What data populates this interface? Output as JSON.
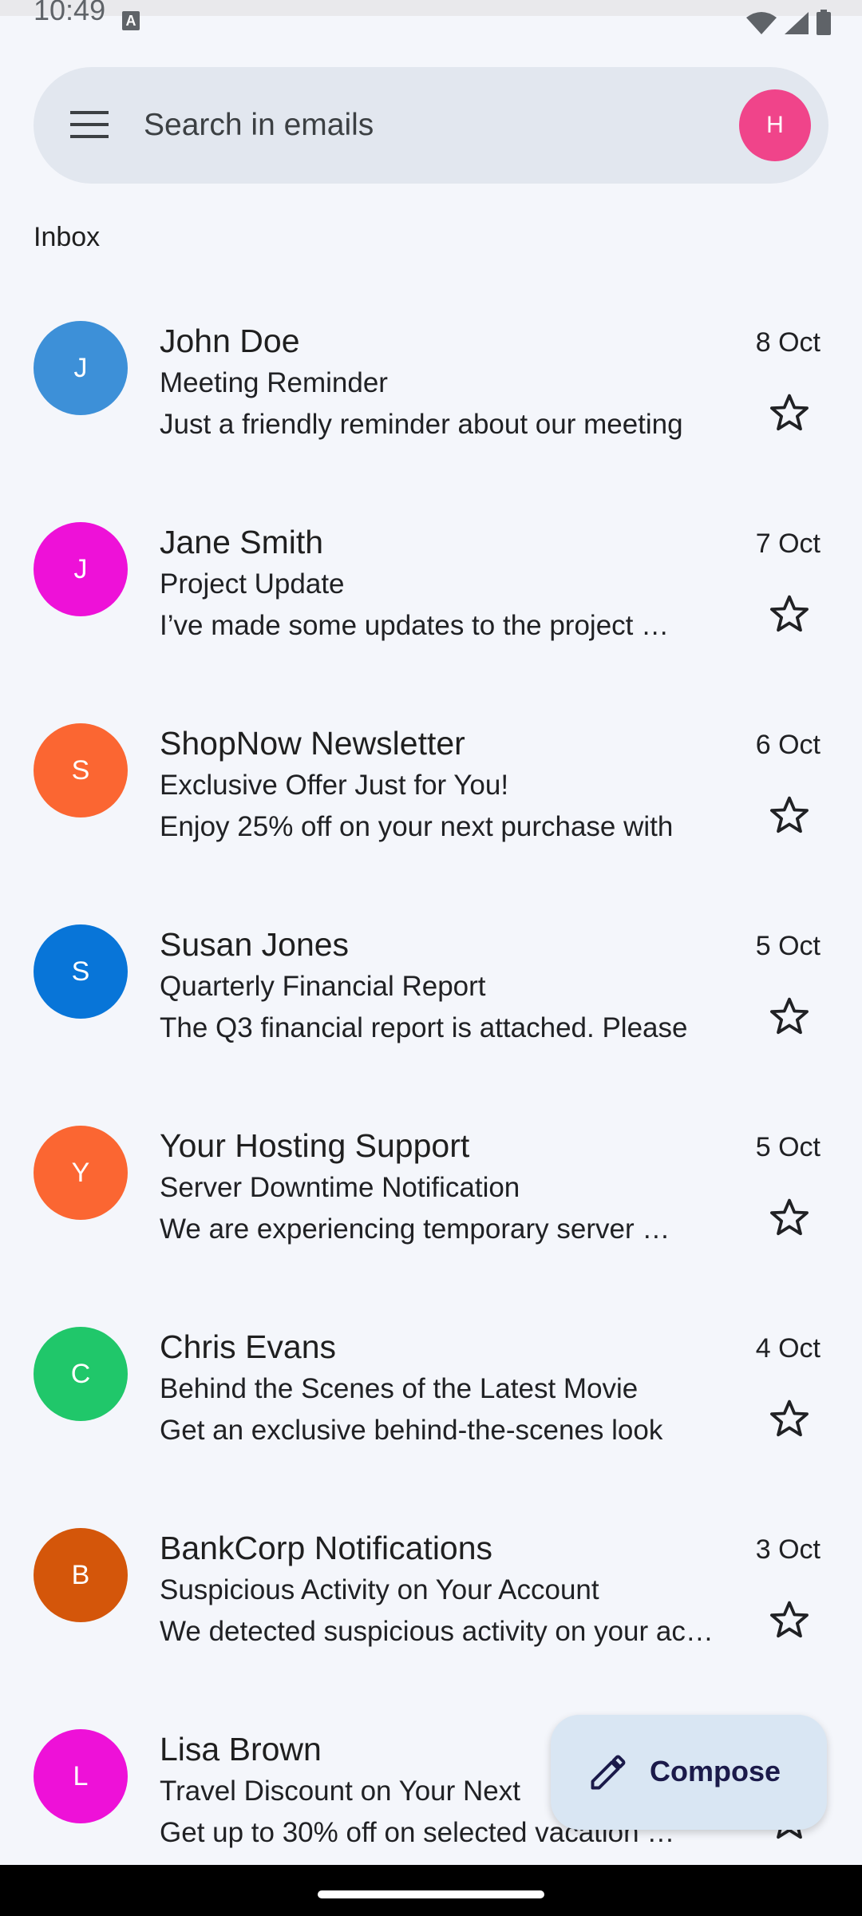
{
  "status_bar": {
    "time": "10:49",
    "indicator": "A",
    "icons": [
      "wifi-icon",
      "signal-icon",
      "battery-icon"
    ]
  },
  "search": {
    "placeholder": "Search in emails",
    "avatar_initial": "H",
    "avatar_color": "#f0448a"
  },
  "section": {
    "label": "Inbox"
  },
  "emails": [
    {
      "initial": "J",
      "color": "#3d90d8",
      "sender": "John Doe",
      "subject": "Meeting Reminder",
      "snippet": "Just a friendly reminder about our meeting",
      "date": "8 Oct",
      "starred": false
    },
    {
      "initial": "J",
      "color": "#ee11d8",
      "sender": "Jane Smith",
      "subject": "Project Update",
      "snippet": "I’ve made some updates to the project …",
      "date": "7 Oct",
      "starred": false
    },
    {
      "initial": "S",
      "color": "#fb6632",
      "sender": "ShopNow Newsletter",
      "subject": "Exclusive Offer Just for You!",
      "snippet": "Enjoy 25% off on your next purchase with",
      "date": "6 Oct",
      "starred": false
    },
    {
      "initial": "S",
      "color": "#0875d8",
      "sender": "Susan Jones",
      "subject": "Quarterly Financial Report",
      "snippet": "The Q3 financial report is attached. Please",
      "date": "5 Oct",
      "starred": false
    },
    {
      "initial": "Y",
      "color": "#fb6632",
      "sender": "Your Hosting Support",
      "subject": "Server Downtime Notification",
      "snippet": "We are experiencing temporary server …",
      "date": "5 Oct",
      "starred": false
    },
    {
      "initial": "C",
      "color": "#20c76a",
      "sender": "Chris Evans",
      "subject": "Behind the Scenes of the Latest Movie",
      "snippet": "Get an exclusive behind-the-scenes look",
      "date": "4 Oct",
      "starred": false
    },
    {
      "initial": "B",
      "color": "#d4560a",
      "sender": "BankCorp Notifications",
      "subject": "Suspicious Activity on Your Account",
      "snippet": "We detected suspicious activity on your account",
      "date": "3 Oct",
      "starred": false
    },
    {
      "initial": "L",
      "color": "#ee11d8",
      "sender": "Lisa Brown",
      "subject": "Travel Discount on Your Next",
      "snippet": "Get up to 30% off on selected vacation …",
      "date": "",
      "starred": false
    }
  ],
  "fab": {
    "label": "Compose",
    "icon": "pencil-icon"
  }
}
